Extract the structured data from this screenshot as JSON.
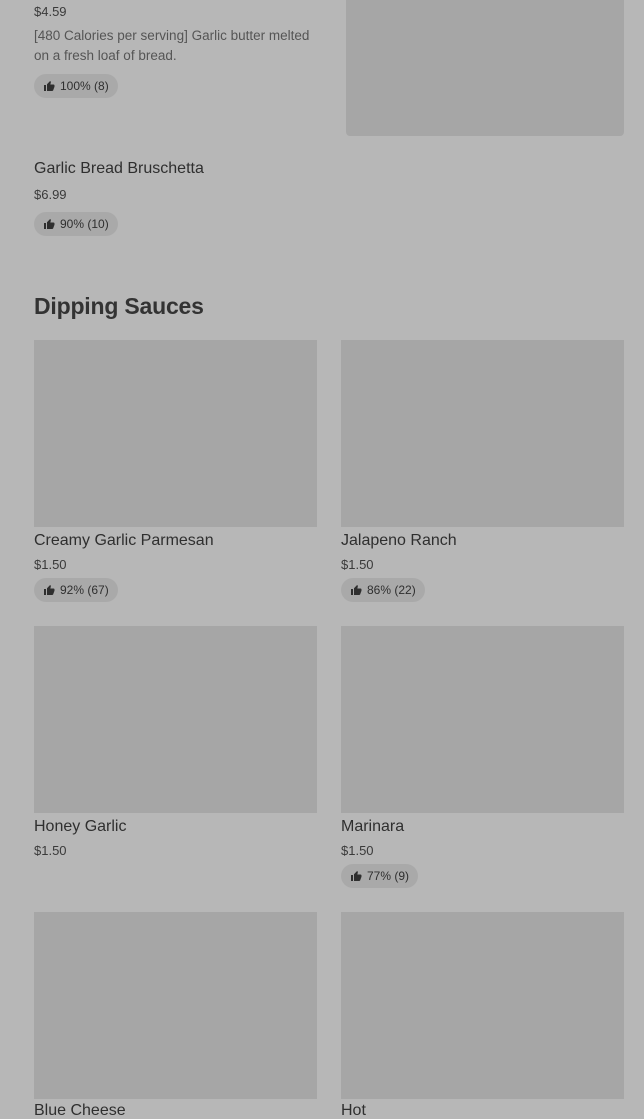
{
  "top_item": {
    "price": "$4.59",
    "description_line1": "[480 Calories per serving] Garlic butter melted",
    "description_line2": "on a fresh loaf of bread.",
    "rating": "100% (8)"
  },
  "item2": {
    "name": "Garlic Bread Bruschetta",
    "price": "$6.99",
    "rating": "90% (10)"
  },
  "section": {
    "title": "Dipping Sauces"
  },
  "sauces": [
    {
      "name": "Creamy Garlic Parmesan",
      "price": "$1.50",
      "rating": "92% (67)"
    },
    {
      "name": "Jalapeno Ranch",
      "price": "$1.50",
      "rating": "86% (22)"
    },
    {
      "name": "Honey Garlic",
      "price": "$1.50",
      "rating": ""
    },
    {
      "name": "Marinara",
      "price": "$1.50",
      "rating": "77% (9)"
    },
    {
      "name": "Blue Cheese",
      "price": "",
      "rating": ""
    },
    {
      "name": "Hot",
      "price": "",
      "rating": ""
    }
  ],
  "icons": {
    "rating": "thumbs-up-icon"
  }
}
